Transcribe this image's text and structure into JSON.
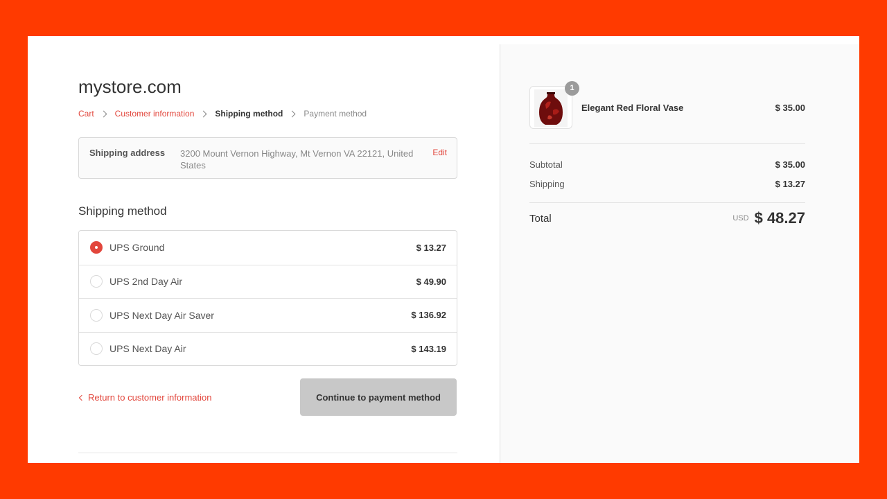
{
  "store": {
    "title": "mystore.com"
  },
  "breadcrumb": {
    "cart": "Cart",
    "customer_information": "Customer information",
    "shipping_method": "Shipping method",
    "payment_method": "Payment method"
  },
  "shipping_address": {
    "label": "Shipping address",
    "value": "3200 Mount Vernon Highway, Mt Vernon VA 22121, United States",
    "edit_label": "Edit"
  },
  "shipping_method": {
    "title": "Shipping method",
    "selected_index": 0,
    "options": [
      {
        "name": "UPS Ground",
        "price": "$ 13.27"
      },
      {
        "name": "UPS 2nd Day Air",
        "price": "$ 49.90"
      },
      {
        "name": "UPS Next Day Air Saver",
        "price": "$ 136.92"
      },
      {
        "name": "UPS Next Day Air",
        "price": "$ 143.19"
      }
    ]
  },
  "actions": {
    "return_label": "Return to customer information",
    "continue_label": "Continue to payment method"
  },
  "order_summary": {
    "product": {
      "name": "Elegant Red Floral Vase",
      "price": "$ 35.00",
      "quantity": "1"
    },
    "subtotal_label": "Subtotal",
    "subtotal_value": "$ 35.00",
    "shipping_label": "Shipping",
    "shipping_value": "$ 13.27",
    "total_label": "Total",
    "currency": "USD",
    "total_value": "$ 48.27"
  },
  "colors": {
    "accent": "#e2463c",
    "page_background": "#ff3a00",
    "button_disabled": "#c8c8c8"
  }
}
